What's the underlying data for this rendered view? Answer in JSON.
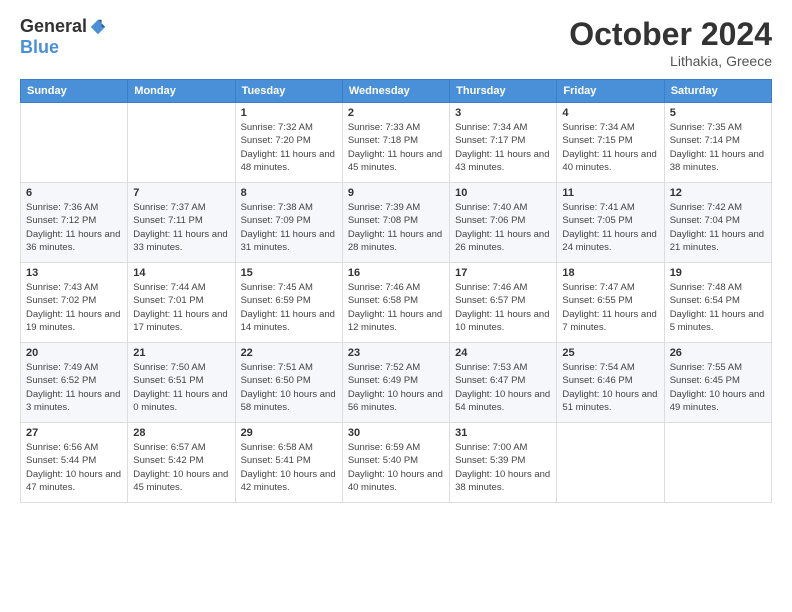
{
  "logo": {
    "general": "General",
    "blue": "Blue"
  },
  "title": "October 2024",
  "location": "Lithakia, Greece",
  "days_header": [
    "Sunday",
    "Monday",
    "Tuesday",
    "Wednesday",
    "Thursday",
    "Friday",
    "Saturday"
  ],
  "weeks": [
    [
      {
        "day": "",
        "info": ""
      },
      {
        "day": "",
        "info": ""
      },
      {
        "day": "1",
        "info": "Sunrise: 7:32 AM\nSunset: 7:20 PM\nDaylight: 11 hours and 48 minutes."
      },
      {
        "day": "2",
        "info": "Sunrise: 7:33 AM\nSunset: 7:18 PM\nDaylight: 11 hours and 45 minutes."
      },
      {
        "day": "3",
        "info": "Sunrise: 7:34 AM\nSunset: 7:17 PM\nDaylight: 11 hours and 43 minutes."
      },
      {
        "day": "4",
        "info": "Sunrise: 7:34 AM\nSunset: 7:15 PM\nDaylight: 11 hours and 40 minutes."
      },
      {
        "day": "5",
        "info": "Sunrise: 7:35 AM\nSunset: 7:14 PM\nDaylight: 11 hours and 38 minutes."
      }
    ],
    [
      {
        "day": "6",
        "info": "Sunrise: 7:36 AM\nSunset: 7:12 PM\nDaylight: 11 hours and 36 minutes."
      },
      {
        "day": "7",
        "info": "Sunrise: 7:37 AM\nSunset: 7:11 PM\nDaylight: 11 hours and 33 minutes."
      },
      {
        "day": "8",
        "info": "Sunrise: 7:38 AM\nSunset: 7:09 PM\nDaylight: 11 hours and 31 minutes."
      },
      {
        "day": "9",
        "info": "Sunrise: 7:39 AM\nSunset: 7:08 PM\nDaylight: 11 hours and 28 minutes."
      },
      {
        "day": "10",
        "info": "Sunrise: 7:40 AM\nSunset: 7:06 PM\nDaylight: 11 hours and 26 minutes."
      },
      {
        "day": "11",
        "info": "Sunrise: 7:41 AM\nSunset: 7:05 PM\nDaylight: 11 hours and 24 minutes."
      },
      {
        "day": "12",
        "info": "Sunrise: 7:42 AM\nSunset: 7:04 PM\nDaylight: 11 hours and 21 minutes."
      }
    ],
    [
      {
        "day": "13",
        "info": "Sunrise: 7:43 AM\nSunset: 7:02 PM\nDaylight: 11 hours and 19 minutes."
      },
      {
        "day": "14",
        "info": "Sunrise: 7:44 AM\nSunset: 7:01 PM\nDaylight: 11 hours and 17 minutes."
      },
      {
        "day": "15",
        "info": "Sunrise: 7:45 AM\nSunset: 6:59 PM\nDaylight: 11 hours and 14 minutes."
      },
      {
        "day": "16",
        "info": "Sunrise: 7:46 AM\nSunset: 6:58 PM\nDaylight: 11 hours and 12 minutes."
      },
      {
        "day": "17",
        "info": "Sunrise: 7:46 AM\nSunset: 6:57 PM\nDaylight: 11 hours and 10 minutes."
      },
      {
        "day": "18",
        "info": "Sunrise: 7:47 AM\nSunset: 6:55 PM\nDaylight: 11 hours and 7 minutes."
      },
      {
        "day": "19",
        "info": "Sunrise: 7:48 AM\nSunset: 6:54 PM\nDaylight: 11 hours and 5 minutes."
      }
    ],
    [
      {
        "day": "20",
        "info": "Sunrise: 7:49 AM\nSunset: 6:52 PM\nDaylight: 11 hours and 3 minutes."
      },
      {
        "day": "21",
        "info": "Sunrise: 7:50 AM\nSunset: 6:51 PM\nDaylight: 11 hours and 0 minutes."
      },
      {
        "day": "22",
        "info": "Sunrise: 7:51 AM\nSunset: 6:50 PM\nDaylight: 10 hours and 58 minutes."
      },
      {
        "day": "23",
        "info": "Sunrise: 7:52 AM\nSunset: 6:49 PM\nDaylight: 10 hours and 56 minutes."
      },
      {
        "day": "24",
        "info": "Sunrise: 7:53 AM\nSunset: 6:47 PM\nDaylight: 10 hours and 54 minutes."
      },
      {
        "day": "25",
        "info": "Sunrise: 7:54 AM\nSunset: 6:46 PM\nDaylight: 10 hours and 51 minutes."
      },
      {
        "day": "26",
        "info": "Sunrise: 7:55 AM\nSunset: 6:45 PM\nDaylight: 10 hours and 49 minutes."
      }
    ],
    [
      {
        "day": "27",
        "info": "Sunrise: 6:56 AM\nSunset: 5:44 PM\nDaylight: 10 hours and 47 minutes."
      },
      {
        "day": "28",
        "info": "Sunrise: 6:57 AM\nSunset: 5:42 PM\nDaylight: 10 hours and 45 minutes."
      },
      {
        "day": "29",
        "info": "Sunrise: 6:58 AM\nSunset: 5:41 PM\nDaylight: 10 hours and 42 minutes."
      },
      {
        "day": "30",
        "info": "Sunrise: 6:59 AM\nSunset: 5:40 PM\nDaylight: 10 hours and 40 minutes."
      },
      {
        "day": "31",
        "info": "Sunrise: 7:00 AM\nSunset: 5:39 PM\nDaylight: 10 hours and 38 minutes."
      },
      {
        "day": "",
        "info": ""
      },
      {
        "day": "",
        "info": ""
      }
    ]
  ]
}
